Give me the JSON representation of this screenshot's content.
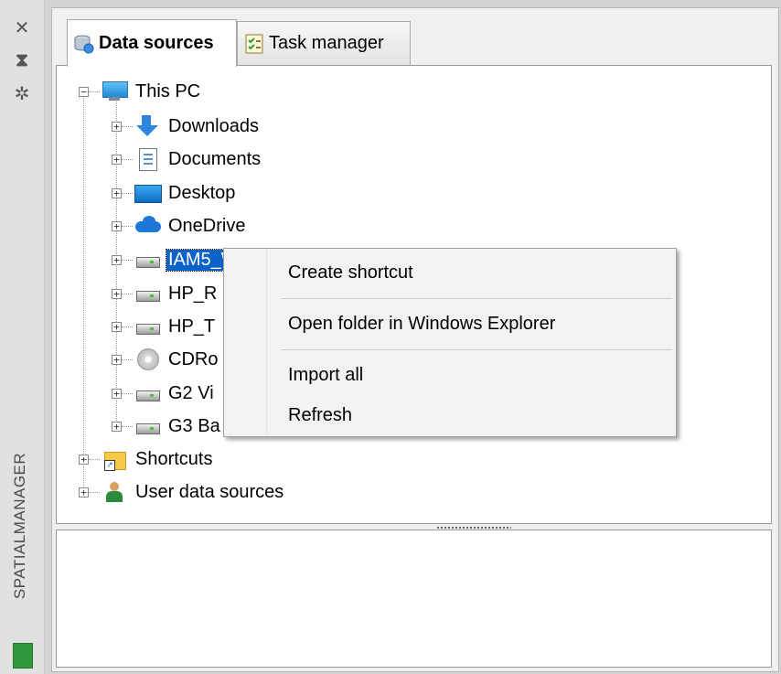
{
  "side_strip": {
    "close_icon": "close-icon",
    "pin_icon": "pin-icon",
    "settings_icon": "settings-icon",
    "vertical_title": "SPATIALMANAGER",
    "app_icon": "spatial-manager-app-icon"
  },
  "tabs": [
    {
      "label": "Data sources",
      "icon": "database-icon",
      "active": true
    },
    {
      "label": "Task manager",
      "icon": "checklist-icon",
      "active": false
    }
  ],
  "tree": {
    "root": {
      "label": "This PC",
      "icon": "monitor-icon",
      "expanded": true
    },
    "children": [
      {
        "label": "Downloads",
        "icon": "download-arrow-icon"
      },
      {
        "label": "Documents",
        "icon": "document-icon"
      },
      {
        "label": "Desktop",
        "icon": "desktop-icon"
      },
      {
        "label": "OneDrive",
        "icon": "cloud-icon"
      },
      {
        "label": "IAM5_W10 (C:)",
        "icon": "drive-icon",
        "selected": true
      },
      {
        "label": "HP_R",
        "icon": "drive-icon"
      },
      {
        "label": "HP_T",
        "icon": "drive-icon"
      },
      {
        "label": "CDRo",
        "icon": "cd-icon"
      },
      {
        "label": "G2 Vi",
        "icon": "drive-icon"
      },
      {
        "label": "G3 Ba",
        "icon": "drive-icon"
      }
    ],
    "top_level": [
      {
        "label": "Shortcuts",
        "icon": "shortcut-folder-icon"
      },
      {
        "label": "User data sources",
        "icon": "user-icon"
      }
    ]
  },
  "context_menu": {
    "items": [
      {
        "label": "Create shortcut"
      },
      {
        "label": "Open folder in Windows Explorer"
      },
      {
        "label": "Import all"
      },
      {
        "label": "Refresh"
      }
    ]
  },
  "colors": {
    "selection": "#0b63c9",
    "app_badge": "#2e9a3b"
  }
}
